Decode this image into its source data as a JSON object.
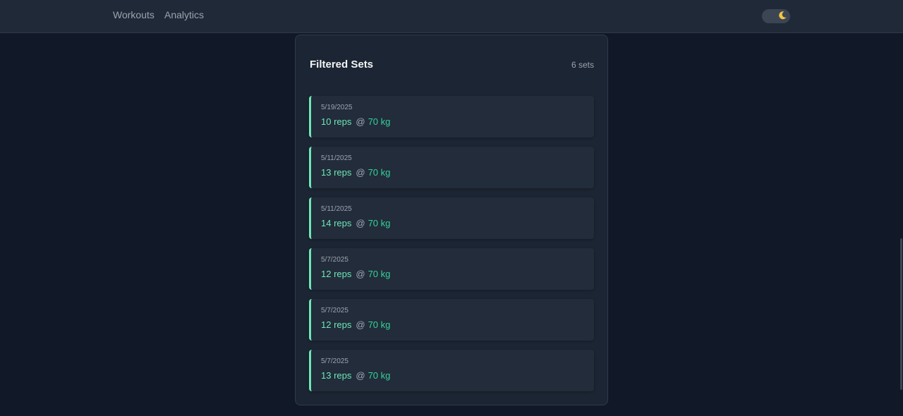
{
  "nav": {
    "items": [
      {
        "label": "Workouts"
      },
      {
        "label": "Analytics"
      }
    ],
    "theme_toggle_icon": "moon-icon"
  },
  "card": {
    "title": "Filtered Sets",
    "count": "6 sets",
    "sets": [
      {
        "date": "5/19/2025",
        "reps": "10 reps",
        "at": "@",
        "weight": "70 kg"
      },
      {
        "date": "5/11/2025",
        "reps": "13 reps",
        "at": "@",
        "weight": "70 kg"
      },
      {
        "date": "5/11/2025",
        "reps": "14 reps",
        "at": "@",
        "weight": "70 kg"
      },
      {
        "date": "5/7/2025",
        "reps": "12 reps",
        "at": "@",
        "weight": "70 kg"
      },
      {
        "date": "5/7/2025",
        "reps": "12 reps",
        "at": "@",
        "weight": "70 kg"
      },
      {
        "date": "5/7/2025",
        "reps": "13 reps",
        "at": "@",
        "weight": "70 kg"
      }
    ]
  },
  "colors": {
    "background": "#111827",
    "accent": "#6ee7b7",
    "weight": "#34d399"
  }
}
